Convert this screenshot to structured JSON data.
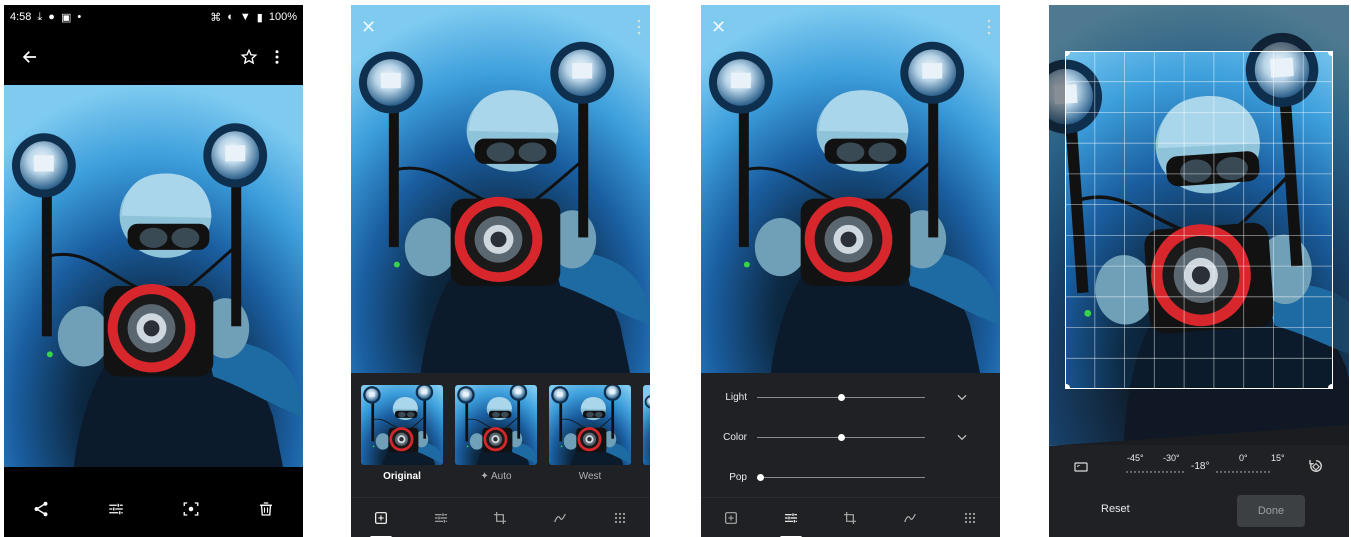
{
  "screen1": {
    "status": {
      "time": "4:58",
      "battery": "100%"
    },
    "topbar": {
      "back_icon": "arrow-left-icon",
      "star_icon": "star-icon",
      "more_icon": "more-vert-icon"
    },
    "actions": [
      "share-icon",
      "edit-icon",
      "lens-icon",
      "delete-icon"
    ]
  },
  "screen2": {
    "filters": [
      {
        "label": "Original",
        "active": true
      },
      {
        "label": "Auto",
        "active": false
      },
      {
        "label": "West",
        "active": false
      }
    ],
    "tabs": [
      "suggestions-icon",
      "adjust-icon",
      "crop-rotate-icon",
      "markup-icon",
      "more-tools-icon"
    ]
  },
  "screen3": {
    "sliders": [
      {
        "label": "Light",
        "value": 0.5
      },
      {
        "label": "Color",
        "value": 0.5
      },
      {
        "label": "Pop",
        "value": 0.0
      }
    ]
  },
  "screen4": {
    "angles": [
      "-45°",
      "-30°",
      "-18°",
      "0°",
      "15°"
    ],
    "reset": "Reset",
    "done": "Done"
  },
  "colors": {
    "chrome": "#202124",
    "water_light": "#79c7ee",
    "water_dark": "#0d2a44",
    "camera_ring": "#d7272d"
  }
}
